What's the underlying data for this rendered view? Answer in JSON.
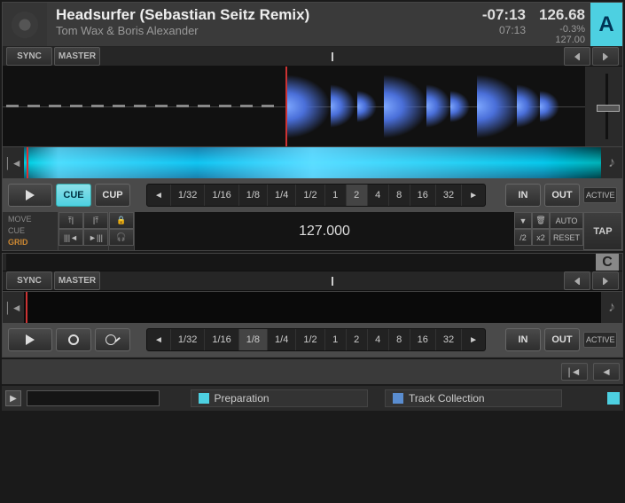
{
  "deck_a": {
    "letter": "A",
    "title": "Headsurfer (Sebastian Seitz Remix)",
    "artist": "Tom Wax & Boris Alexander",
    "time_remaining": "-07:13",
    "time_elapsed": "07:13",
    "tempo": "126.68",
    "tempo_offset": "-0.3%",
    "tempo_base": "127.00",
    "sync": "SYNC",
    "master": "MASTER",
    "cue": "CUE",
    "cup": "CUP",
    "in": "IN",
    "out": "OUT",
    "active": "ACTIVE",
    "beat_jumps": [
      "1/32",
      "1/16",
      "1/8",
      "1/4",
      "1/2",
      "1",
      "2",
      "4",
      "8",
      "16",
      "32"
    ],
    "beat_selected": "2",
    "grid": {
      "move": "MOVE",
      "cue": "CUE",
      "grid": "GRID",
      "bpm": "127.000",
      "auto": "AUTO",
      "reset": "RESET",
      "half": "/2",
      "double": "x2",
      "tap": "TAP"
    }
  },
  "deck_c": {
    "letter": "C",
    "sync": "SYNC",
    "master": "MASTER",
    "in": "IN",
    "out": "OUT",
    "active": "ACTIVE",
    "beat_jumps": [
      "1/32",
      "1/16",
      "1/8",
      "1/4",
      "1/2",
      "1",
      "2",
      "4",
      "8",
      "16",
      "32"
    ],
    "beat_selected": "1/8"
  },
  "browser": {
    "preparation": "Preparation",
    "collection": "Track Collection"
  }
}
